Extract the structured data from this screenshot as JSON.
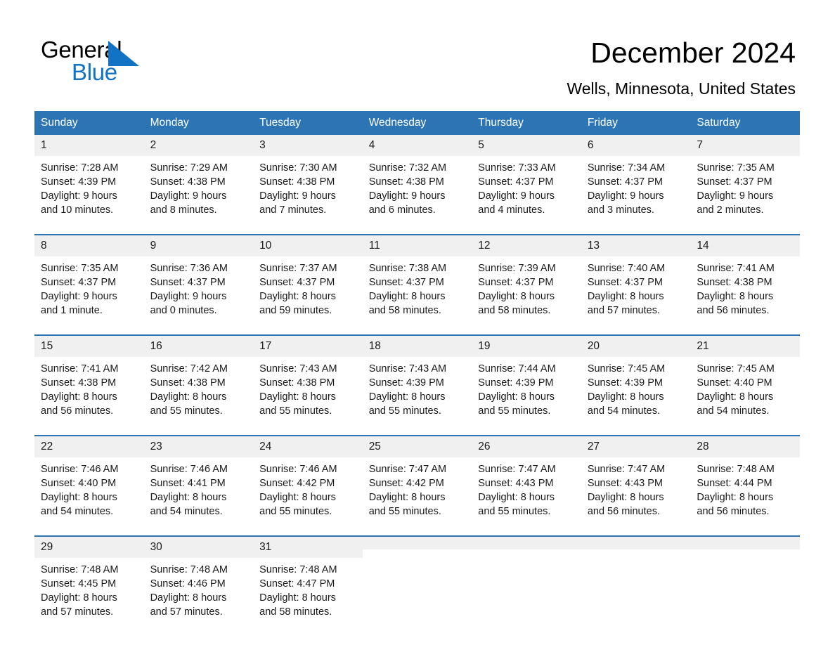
{
  "brand": {
    "name_part1": "General",
    "name_part2": "Blue",
    "triangle_color": "#1273c4",
    "blue_color": "#1273c4"
  },
  "header": {
    "title": "December 2024",
    "location": "Wells, Minnesota, United States"
  },
  "theme": {
    "header_blue": "#2c74b3",
    "daynum_gray": "#f0f0f0",
    "rule_blue": "#2c74b3"
  },
  "weekday_headers": [
    "Sunday",
    "Monday",
    "Tuesday",
    "Wednesday",
    "Thursday",
    "Friday",
    "Saturday"
  ],
  "weeks": [
    [
      {
        "day": "1",
        "sunrise": "Sunrise: 7:28 AM",
        "sunset": "Sunset: 4:39 PM",
        "daylight_line1": "Daylight: 9 hours",
        "daylight_line2": "and 10 minutes."
      },
      {
        "day": "2",
        "sunrise": "Sunrise: 7:29 AM",
        "sunset": "Sunset: 4:38 PM",
        "daylight_line1": "Daylight: 9 hours",
        "daylight_line2": "and 8 minutes."
      },
      {
        "day": "3",
        "sunrise": "Sunrise: 7:30 AM",
        "sunset": "Sunset: 4:38 PM",
        "daylight_line1": "Daylight: 9 hours",
        "daylight_line2": "and 7 minutes."
      },
      {
        "day": "4",
        "sunrise": "Sunrise: 7:32 AM",
        "sunset": "Sunset: 4:38 PM",
        "daylight_line1": "Daylight: 9 hours",
        "daylight_line2": "and 6 minutes."
      },
      {
        "day": "5",
        "sunrise": "Sunrise: 7:33 AM",
        "sunset": "Sunset: 4:37 PM",
        "daylight_line1": "Daylight: 9 hours",
        "daylight_line2": "and 4 minutes."
      },
      {
        "day": "6",
        "sunrise": "Sunrise: 7:34 AM",
        "sunset": "Sunset: 4:37 PM",
        "daylight_line1": "Daylight: 9 hours",
        "daylight_line2": "and 3 minutes."
      },
      {
        "day": "7",
        "sunrise": "Sunrise: 7:35 AM",
        "sunset": "Sunset: 4:37 PM",
        "daylight_line1": "Daylight: 9 hours",
        "daylight_line2": "and 2 minutes."
      }
    ],
    [
      {
        "day": "8",
        "sunrise": "Sunrise: 7:35 AM",
        "sunset": "Sunset: 4:37 PM",
        "daylight_line1": "Daylight: 9 hours",
        "daylight_line2": "and 1 minute."
      },
      {
        "day": "9",
        "sunrise": "Sunrise: 7:36 AM",
        "sunset": "Sunset: 4:37 PM",
        "daylight_line1": "Daylight: 9 hours",
        "daylight_line2": "and 0 minutes."
      },
      {
        "day": "10",
        "sunrise": "Sunrise: 7:37 AM",
        "sunset": "Sunset: 4:37 PM",
        "daylight_line1": "Daylight: 8 hours",
        "daylight_line2": "and 59 minutes."
      },
      {
        "day": "11",
        "sunrise": "Sunrise: 7:38 AM",
        "sunset": "Sunset: 4:37 PM",
        "daylight_line1": "Daylight: 8 hours",
        "daylight_line2": "and 58 minutes."
      },
      {
        "day": "12",
        "sunrise": "Sunrise: 7:39 AM",
        "sunset": "Sunset: 4:37 PM",
        "daylight_line1": "Daylight: 8 hours",
        "daylight_line2": "and 58 minutes."
      },
      {
        "day": "13",
        "sunrise": "Sunrise: 7:40 AM",
        "sunset": "Sunset: 4:37 PM",
        "daylight_line1": "Daylight: 8 hours",
        "daylight_line2": "and 57 minutes."
      },
      {
        "day": "14",
        "sunrise": "Sunrise: 7:41 AM",
        "sunset": "Sunset: 4:38 PM",
        "daylight_line1": "Daylight: 8 hours",
        "daylight_line2": "and 56 minutes."
      }
    ],
    [
      {
        "day": "15",
        "sunrise": "Sunrise: 7:41 AM",
        "sunset": "Sunset: 4:38 PM",
        "daylight_line1": "Daylight: 8 hours",
        "daylight_line2": "and 56 minutes."
      },
      {
        "day": "16",
        "sunrise": "Sunrise: 7:42 AM",
        "sunset": "Sunset: 4:38 PM",
        "daylight_line1": "Daylight: 8 hours",
        "daylight_line2": "and 55 minutes."
      },
      {
        "day": "17",
        "sunrise": "Sunrise: 7:43 AM",
        "sunset": "Sunset: 4:38 PM",
        "daylight_line1": "Daylight: 8 hours",
        "daylight_line2": "and 55 minutes."
      },
      {
        "day": "18",
        "sunrise": "Sunrise: 7:43 AM",
        "sunset": "Sunset: 4:39 PM",
        "daylight_line1": "Daylight: 8 hours",
        "daylight_line2": "and 55 minutes."
      },
      {
        "day": "19",
        "sunrise": "Sunrise: 7:44 AM",
        "sunset": "Sunset: 4:39 PM",
        "daylight_line1": "Daylight: 8 hours",
        "daylight_line2": "and 55 minutes."
      },
      {
        "day": "20",
        "sunrise": "Sunrise: 7:45 AM",
        "sunset": "Sunset: 4:39 PM",
        "daylight_line1": "Daylight: 8 hours",
        "daylight_line2": "and 54 minutes."
      },
      {
        "day": "21",
        "sunrise": "Sunrise: 7:45 AM",
        "sunset": "Sunset: 4:40 PM",
        "daylight_line1": "Daylight: 8 hours",
        "daylight_line2": "and 54 minutes."
      }
    ],
    [
      {
        "day": "22",
        "sunrise": "Sunrise: 7:46 AM",
        "sunset": "Sunset: 4:40 PM",
        "daylight_line1": "Daylight: 8 hours",
        "daylight_line2": "and 54 minutes."
      },
      {
        "day": "23",
        "sunrise": "Sunrise: 7:46 AM",
        "sunset": "Sunset: 4:41 PM",
        "daylight_line1": "Daylight: 8 hours",
        "daylight_line2": "and 54 minutes."
      },
      {
        "day": "24",
        "sunrise": "Sunrise: 7:46 AM",
        "sunset": "Sunset: 4:42 PM",
        "daylight_line1": "Daylight: 8 hours",
        "daylight_line2": "and 55 minutes."
      },
      {
        "day": "25",
        "sunrise": "Sunrise: 7:47 AM",
        "sunset": "Sunset: 4:42 PM",
        "daylight_line1": "Daylight: 8 hours",
        "daylight_line2": "and 55 minutes."
      },
      {
        "day": "26",
        "sunrise": "Sunrise: 7:47 AM",
        "sunset": "Sunset: 4:43 PM",
        "daylight_line1": "Daylight: 8 hours",
        "daylight_line2": "and 55 minutes."
      },
      {
        "day": "27",
        "sunrise": "Sunrise: 7:47 AM",
        "sunset": "Sunset: 4:43 PM",
        "daylight_line1": "Daylight: 8 hours",
        "daylight_line2": "and 56 minutes."
      },
      {
        "day": "28",
        "sunrise": "Sunrise: 7:48 AM",
        "sunset": "Sunset: 4:44 PM",
        "daylight_line1": "Daylight: 8 hours",
        "daylight_line2": "and 56 minutes."
      }
    ],
    [
      {
        "day": "29",
        "sunrise": "Sunrise: 7:48 AM",
        "sunset": "Sunset: 4:45 PM",
        "daylight_line1": "Daylight: 8 hours",
        "daylight_line2": "and 57 minutes."
      },
      {
        "day": "30",
        "sunrise": "Sunrise: 7:48 AM",
        "sunset": "Sunset: 4:46 PM",
        "daylight_line1": "Daylight: 8 hours",
        "daylight_line2": "and 57 minutes."
      },
      {
        "day": "31",
        "sunrise": "Sunrise: 7:48 AM",
        "sunset": "Sunset: 4:47 PM",
        "daylight_line1": "Daylight: 8 hours",
        "daylight_line2": "and 58 minutes."
      },
      {
        "day": "",
        "sunrise": "",
        "sunset": "",
        "daylight_line1": "",
        "daylight_line2": ""
      },
      {
        "day": "",
        "sunrise": "",
        "sunset": "",
        "daylight_line1": "",
        "daylight_line2": ""
      },
      {
        "day": "",
        "sunrise": "",
        "sunset": "",
        "daylight_line1": "",
        "daylight_line2": ""
      },
      {
        "day": "",
        "sunrise": "",
        "sunset": "",
        "daylight_line1": "",
        "daylight_line2": ""
      }
    ]
  ]
}
